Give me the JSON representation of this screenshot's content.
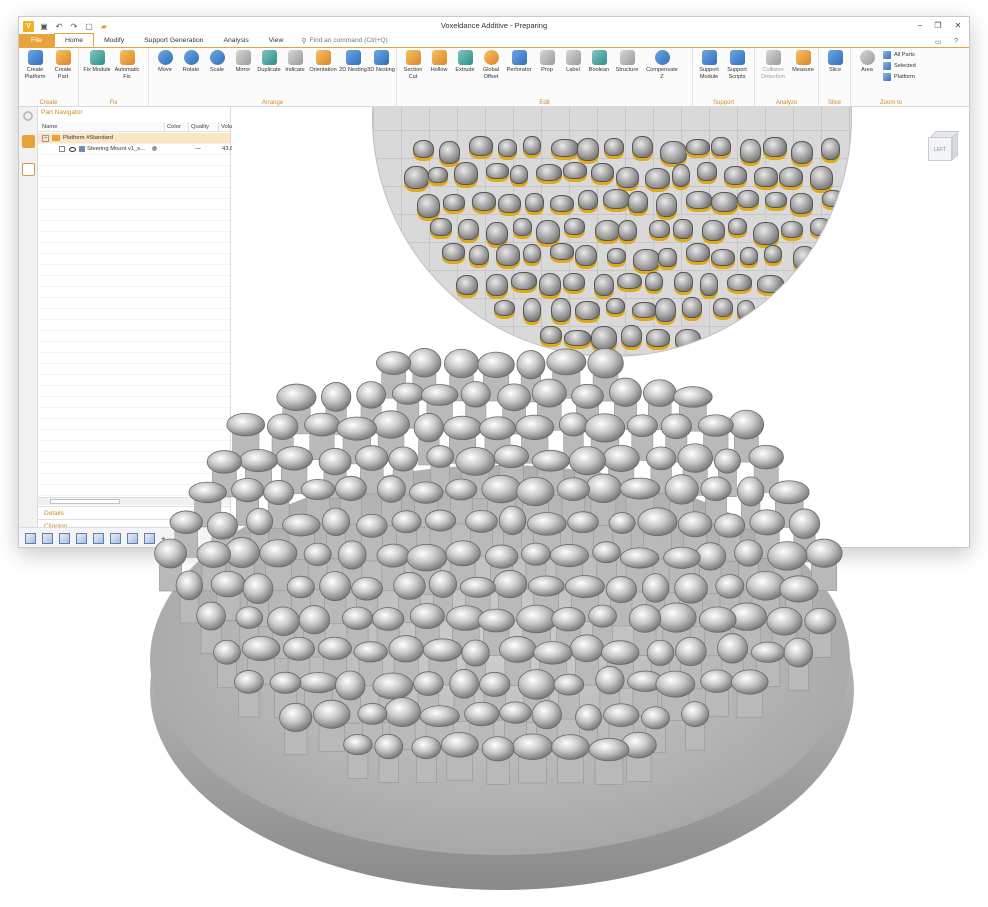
{
  "window": {
    "title": "Voxeldance Additive - Preparing",
    "controls": [
      "–",
      "❐",
      "✕"
    ]
  },
  "tabs": {
    "file": "File",
    "items": [
      "Home",
      "Modify",
      "Support Generation",
      "Analysis",
      "View"
    ],
    "search_placeholder": "Find an command (Ctrl+Q)"
  },
  "ribbon": {
    "groups": [
      {
        "label": "Create",
        "buttons": [
          "Create Platform",
          "Create Part"
        ]
      },
      {
        "label": "Fix",
        "buttons": [
          "Fix Module",
          "Automatic Fix"
        ]
      },
      {
        "label": "Arrange",
        "buttons": [
          "Move",
          "Rotate",
          "Scale",
          "Mirror",
          "Duplicate",
          "Indicate",
          "Orientation",
          "2D Nesting",
          "3D Nesting"
        ]
      },
      {
        "label": "Edit",
        "buttons": [
          "Section Cut",
          "Hollow",
          "Extrude",
          "Global Offset",
          "Perforator",
          "Prop",
          "Label",
          "Boolean",
          "Structure",
          "Compensate Z"
        ]
      },
      {
        "label": "Support",
        "buttons": [
          "Support Module",
          "Support Scripts"
        ]
      },
      {
        "label": "Analyze",
        "buttons": [
          "Collision Detection",
          "Measure"
        ]
      },
      {
        "label": "Slice",
        "buttons": [
          "Slice"
        ]
      },
      {
        "label": "Zoom to",
        "buttons": [
          "Area"
        ],
        "small_buttons": [
          "All Parts",
          "Selected",
          "Platform"
        ]
      }
    ]
  },
  "part_navigator": {
    "title": "Part Navigator",
    "columns": [
      "Name",
      "Color",
      "Quality",
      "Volu"
    ],
    "rows": [
      {
        "name": "Platform #Standard",
        "color": "",
        "quality": "",
        "volume": ""
      },
      {
        "name": "Steering Mount v1_s...",
        "color": "",
        "quality": "—",
        "volume": "43,6"
      }
    ],
    "panels": [
      "Details",
      "Clipping"
    ]
  },
  "viewport": {
    "view_cube_label": "LEFT"
  },
  "colors": {
    "accent": "#e8a33c",
    "support": "#e0a91a",
    "plate": "#d9d9d9"
  }
}
